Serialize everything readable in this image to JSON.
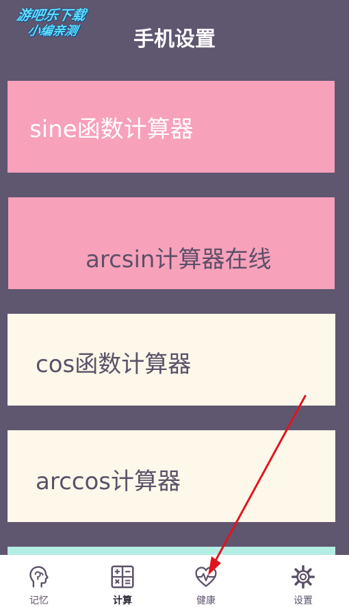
{
  "watermark": {
    "line1": "游吧乐下载",
    "line2": "小编亲测"
  },
  "header": {
    "title": "手机设置"
  },
  "cards": [
    {
      "label": "sine函数计算器"
    },
    {
      "label": "arcsin计算器在线"
    },
    {
      "label": "cos函数计算器"
    },
    {
      "label": "arccos计算器"
    }
  ],
  "tabs": [
    {
      "label": "记忆",
      "icon": "head-brain-icon"
    },
    {
      "label": "计算",
      "icon": "calculator-icon",
      "active": true
    },
    {
      "label": "健康",
      "icon": "heart-pulse-icon"
    },
    {
      "label": "设置",
      "icon": "gear-icon"
    }
  ],
  "colors": {
    "background": "#5f5670",
    "pink": "#f8a1bb",
    "cream": "#fdf8ea",
    "teal": "#b4ede3",
    "text": "#5c5068",
    "arrow": "#e0141e"
  }
}
